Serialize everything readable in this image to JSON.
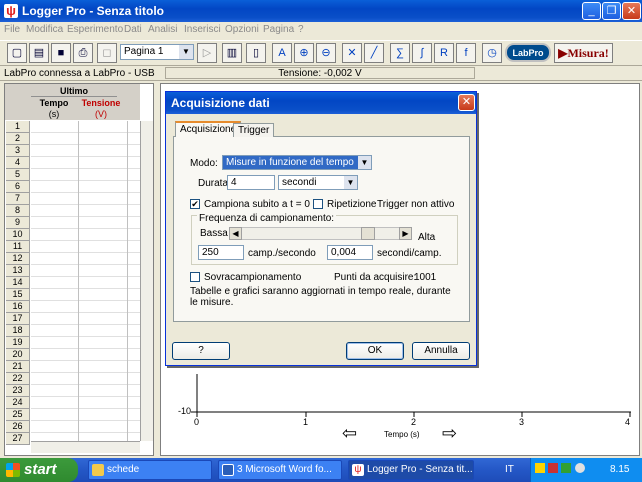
{
  "window": {
    "title": "Logger Pro - Senza titolo",
    "minimize": "_",
    "maximize": "❐",
    "close": "✕"
  },
  "menu": [
    "File",
    "Modifica",
    "Esperimento",
    "Dati",
    "Analisi",
    "Inserisci",
    "Opzioni",
    "Pagina",
    "?"
  ],
  "toolbar": {
    "page_select": "Pagina 1",
    "labpro_label": "LabPro",
    "misura_label": "▶Misura!"
  },
  "status": {
    "connection": "LabPro connessa a LabPro - USB",
    "sensor_reading": "Tensione: -0,002 V"
  },
  "table": {
    "group_header": "Ultimo",
    "columns": [
      {
        "name": "Tempo",
        "unit": "(s)"
      },
      {
        "name": "Tensione",
        "unit": "(V)"
      }
    ],
    "rows": [
      "1",
      "2",
      "3",
      "4",
      "5",
      "6",
      "7",
      "8",
      "9",
      "10",
      "11",
      "12",
      "13",
      "14",
      "15",
      "16",
      "17",
      "18",
      "19",
      "20",
      "21",
      "22",
      "23",
      "24",
      "25",
      "26",
      "27"
    ]
  },
  "graph": {
    "x_ticks": [
      "0",
      "1",
      "2",
      "3",
      "4"
    ],
    "y_ticks": [
      "-10"
    ],
    "x_label": "Tempo (s)",
    "nav_left": "⇦",
    "nav_right": "⇨"
  },
  "dialog": {
    "title": "Acquisizione dati",
    "tabs": [
      "Acquisizione",
      "Trigger"
    ],
    "modo_label": "Modo:",
    "modo_value": "Misure in funzione del tempo",
    "durata_label": "Durata:",
    "durata_value": "4",
    "durata_unit": "secondi",
    "campiona_label": "Campiona subito a t = 0",
    "campiona_checked": true,
    "ripetizione_label": "Ripetizione",
    "ripetizione_checked": false,
    "trigger_status": "Trigger non attivo",
    "freq_group_label": "Frequenza di campionamento:",
    "bassa_label": "Bassa",
    "alta_label": "Alta",
    "rate_value": "250",
    "rate_unit": "camp./secondo",
    "interval_value": "0,004",
    "interval_unit": "secondi/camp.",
    "sovra_label": "Sovracampionamento",
    "sovra_checked": false,
    "punti_label": "Punti da acquisire:",
    "punti_value": "1001",
    "note": "Tabelle e grafici saranno aggiornati in tempo reale, durante le misure.",
    "help_label": "?",
    "ok_label": "OK",
    "cancel_label": "Annulla"
  },
  "taskbar": {
    "start_label": "start",
    "items": [
      {
        "label": "schede"
      },
      {
        "label": "3 Microsoft Word fo..."
      },
      {
        "label": "Logger Pro - Senza tit..."
      }
    ],
    "lang": "IT",
    "clock": "8.15"
  }
}
